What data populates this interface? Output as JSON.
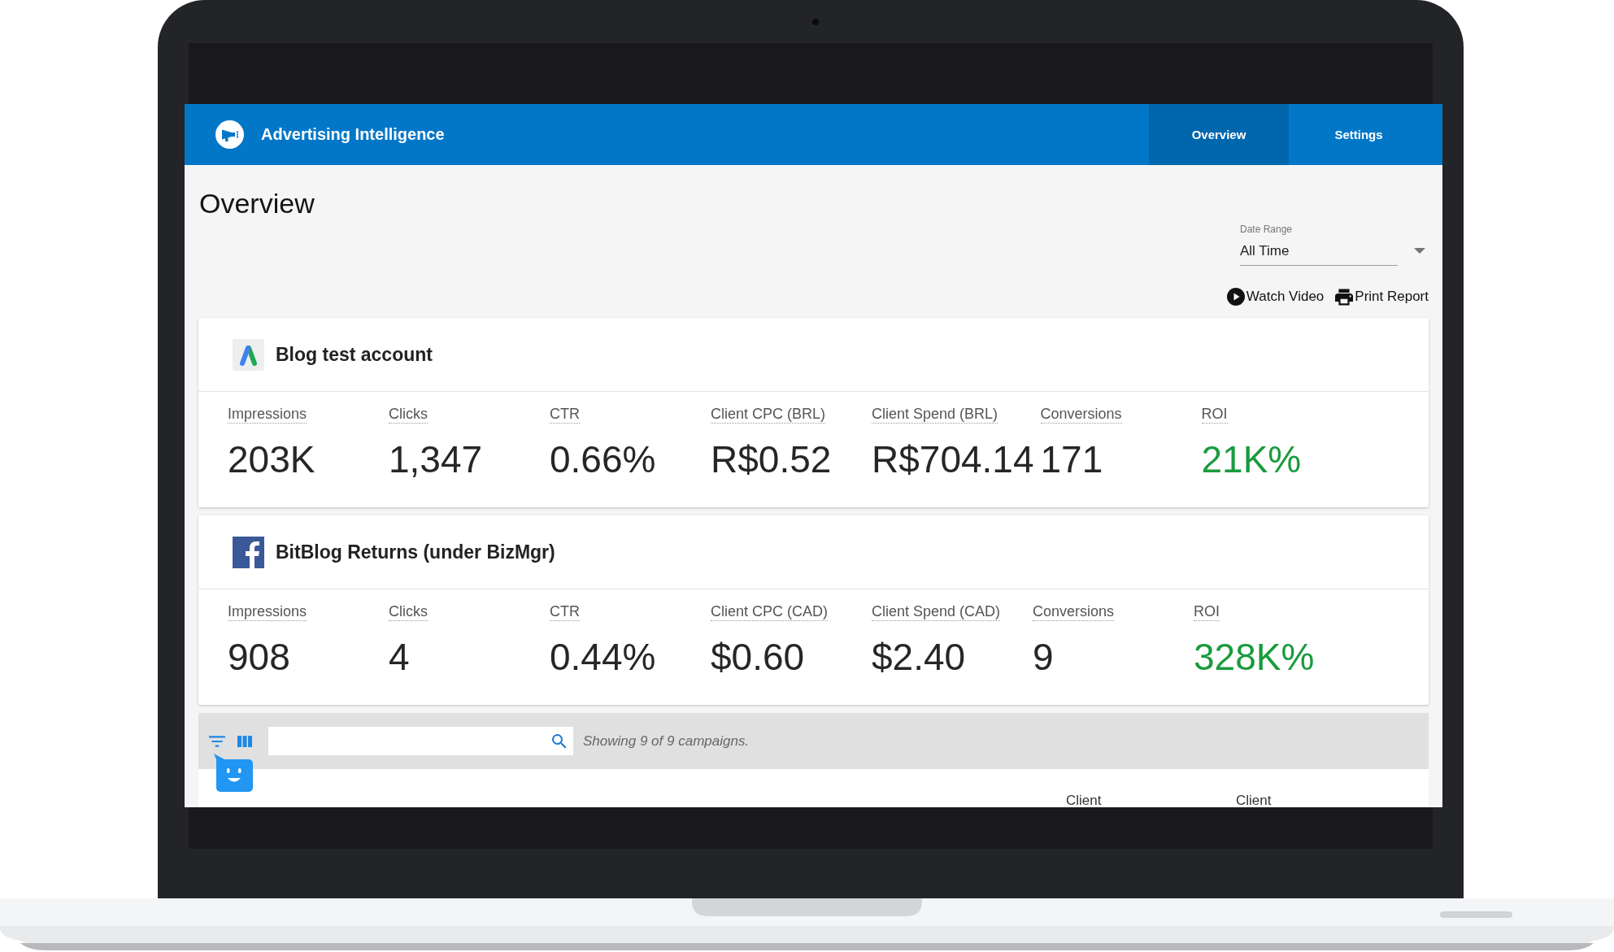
{
  "app": {
    "title": "Advertising Intelligence"
  },
  "tabs": [
    {
      "label": "Overview",
      "selected": true
    },
    {
      "label": "Settings",
      "selected": false
    }
  ],
  "page_title": "Overview",
  "date_range": {
    "label": "Date Range",
    "value": "All Time"
  },
  "actions": [
    {
      "kind": "video",
      "label": "Watch Video"
    },
    {
      "kind": "print",
      "label": "Print Report"
    }
  ],
  "accounts": [
    {
      "kind": "google_ads",
      "name": "Blog test account",
      "metrics": [
        {
          "label": "Impressions",
          "value": "203K",
          "positive": false
        },
        {
          "label": "Clicks",
          "value": "1,347",
          "positive": false
        },
        {
          "label": "CTR",
          "value": "0.66%",
          "positive": false
        },
        {
          "label": "Client CPC (BRL)",
          "value": "R$0.52",
          "positive": false
        },
        {
          "label": "Client Spend (BRL)",
          "value": "R$704.14",
          "positive": false
        },
        {
          "label": "Conversions",
          "value": "171",
          "positive": false
        },
        {
          "label": "ROI",
          "value": "21K%",
          "positive": true
        }
      ]
    },
    {
      "kind": "facebook",
      "name": "BitBlog Returns (under BizMgr)",
      "metrics": [
        {
          "label": "Impressions",
          "value": "908",
          "positive": false
        },
        {
          "label": "Clicks",
          "value": "4",
          "positive": false
        },
        {
          "label": "CTR",
          "value": "0.44%",
          "positive": false
        },
        {
          "label": "Client CPC (CAD)",
          "value": "$0.60",
          "positive": false
        },
        {
          "label": "Client Spend (CAD)",
          "value": "$2.40",
          "positive": false
        },
        {
          "label": "Conversions",
          "value": "9",
          "positive": false
        },
        {
          "label": "ROI",
          "value": "328K%",
          "positive": true
        }
      ]
    }
  ],
  "campaigns": {
    "status_text": "Showing 9 of 9 campaigns.",
    "table": {
      "columns": [
        {
          "label": "Client"
        },
        {
          "label": "Client"
        }
      ]
    }
  }
}
